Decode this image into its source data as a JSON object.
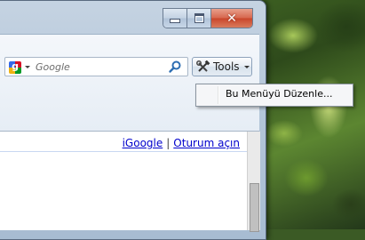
{
  "search": {
    "placeholder": "Google",
    "engine_icon": "google-icon",
    "go_icon": "magnifier-icon"
  },
  "toolbar": {
    "tools_label": "Tools",
    "tools_icon": "hammer-wrench-icon"
  },
  "menu": {
    "items": [
      {
        "label": "Bu Menüyü Düzenle..."
      }
    ]
  },
  "page": {
    "links": [
      {
        "label": "iGoogle"
      },
      {
        "label": "Oturum açın"
      }
    ],
    "separator": "|"
  },
  "colors": {
    "link": "#0000cc",
    "close_button": "#c9452a"
  }
}
